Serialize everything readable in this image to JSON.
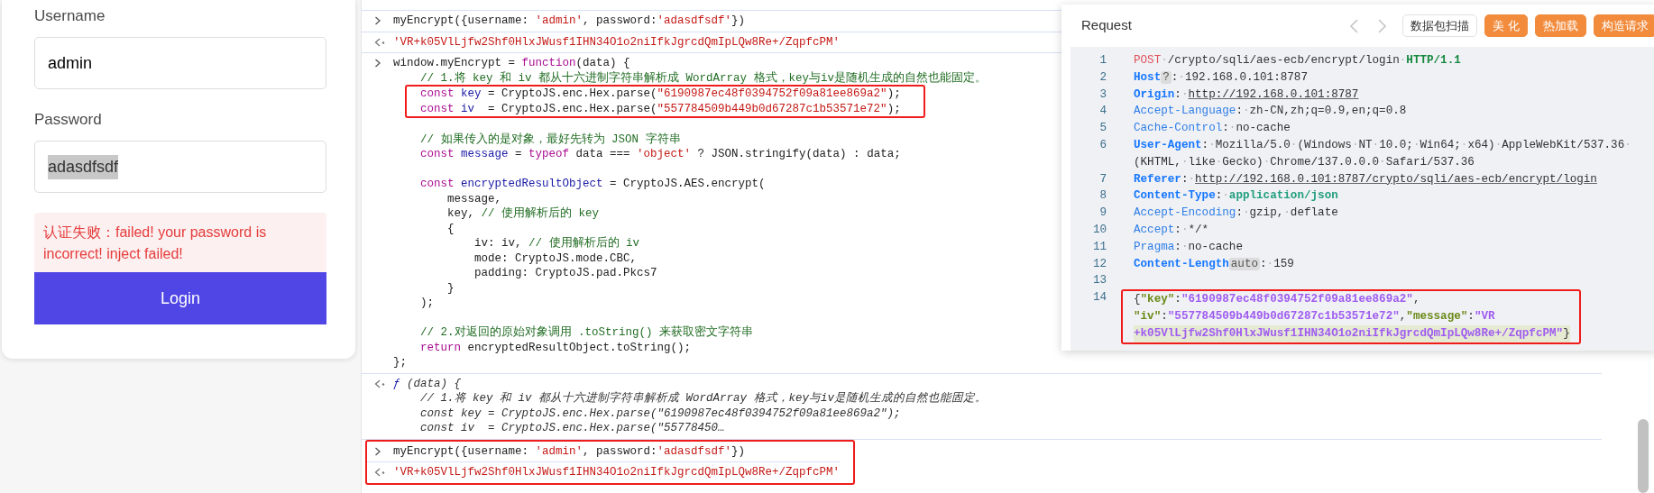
{
  "login_form": {
    "username_label": "Username",
    "username_value": "admin",
    "password_label": "Password",
    "password_value": "adasdfsdf",
    "password_selected": true,
    "error_message": "认证失败：failed! your password is incorrect! inject failed!",
    "login_button": "Login"
  },
  "console": {
    "entries": [
      {
        "kind": "input",
        "boxed": false,
        "lines": [
          {
            "boxed": false,
            "tokens": [
              {
                "kind": "pln",
                "text": "myEncrypt({username: "
              },
              {
                "kind": "str",
                "text": "'admin'"
              },
              {
                "kind": "pln",
                "text": ", password:"
              },
              {
                "kind": "str",
                "text": "'adasdfsdf'"
              },
              {
                "kind": "pln",
                "text": "})"
              }
            ]
          }
        ]
      },
      {
        "kind": "result",
        "boxed": false,
        "lines": [
          {
            "boxed": false,
            "tokens": [
              {
                "kind": "str",
                "text": "'VR+k05VlLjfw2Shf0HlxJWusf1IHN34O1o2niIfkJgrcdQmIpLQw8Re+/ZqpfcPM'"
              }
            ]
          }
        ]
      },
      {
        "kind": "input",
        "boxed": false,
        "lines": [
          {
            "boxed": false,
            "tokens": [
              {
                "kind": "pln",
                "text": "window.myEncrypt = "
              },
              {
                "kind": "kw",
                "text": "function"
              },
              {
                "kind": "pln",
                "text": "(data) {"
              }
            ]
          },
          {
            "boxed": false,
            "tokens": [
              {
                "kind": "com",
                "text": "    // 1.将 key 和 iv 都从十六进制字符串解析成 WordArray 格式，key与iv是随机生成的自然也能固定。"
              }
            ]
          },
          {
            "boxed": true,
            "tokens": [
              {
                "kind": "kw",
                "text": "    const "
              },
              {
                "kind": "def",
                "text": "key"
              },
              {
                "kind": "pln",
                "text": " = CryptoJS.enc.Hex.parse("
              },
              {
                "kind": "str",
                "text": "\"6190987ec48f0394752f09a81ee869a2\""
              },
              {
                "kind": "pln",
                "text": ");"
              }
            ]
          },
          {
            "boxed": true,
            "tokens": [
              {
                "kind": "kw",
                "text": "    const "
              },
              {
                "kind": "def",
                "text": "iv"
              },
              {
                "kind": "pln",
                "text": "  = CryptoJS.enc.Hex.parse("
              },
              {
                "kind": "str",
                "text": "\"557784509b449b0d67287c1b53571e72\""
              },
              {
                "kind": "pln",
                "text": ");"
              }
            ]
          },
          {
            "boxed": false
          },
          {
            "boxed": false,
            "tokens": [
              {
                "kind": "com",
                "text": "    // 如果传入的是对象，最好先转为 JSON 字符串"
              }
            ]
          },
          {
            "boxed": false,
            "tokens": [
              {
                "kind": "kw",
                "text": "    const "
              },
              {
                "kind": "def",
                "text": "message"
              },
              {
                "kind": "pln",
                "text": " = "
              },
              {
                "kind": "kw",
                "text": "typeof"
              },
              {
                "kind": "pln",
                "text": " data === "
              },
              {
                "kind": "str",
                "text": "'object'"
              },
              {
                "kind": "pln",
                "text": " ? JSON.stringify(data) : data;"
              }
            ]
          },
          {
            "boxed": false
          },
          {
            "boxed": false,
            "tokens": [
              {
                "kind": "kw",
                "text": "    const "
              },
              {
                "kind": "def",
                "text": "encryptedResultObject"
              },
              {
                "kind": "pln",
                "text": " = CryptoJS.AES.encrypt("
              }
            ]
          },
          {
            "boxed": false,
            "tokens": [
              {
                "kind": "pln",
                "text": "        message,"
              }
            ]
          },
          {
            "boxed": false,
            "tokens": [
              {
                "kind": "pln",
                "text": "        key, "
              },
              {
                "kind": "com",
                "text": "// 使用解析后的 key"
              }
            ]
          },
          {
            "boxed": false,
            "tokens": [
              {
                "kind": "pln",
                "text": "        {"
              }
            ]
          },
          {
            "boxed": false,
            "tokens": [
              {
                "kind": "pln",
                "text": "            iv: iv, "
              },
              {
                "kind": "com",
                "text": "// 使用解析后的 iv"
              }
            ]
          },
          {
            "boxed": false,
            "tokens": [
              {
                "kind": "pln",
                "text": "            mode: CryptoJS.mode.CBC,"
              }
            ]
          },
          {
            "boxed": false,
            "tokens": [
              {
                "kind": "pln",
                "text": "            padding: CryptoJS.pad.Pkcs7"
              }
            ]
          },
          {
            "boxed": false,
            "tokens": [
              {
                "kind": "pln",
                "text": "        }"
              }
            ]
          },
          {
            "boxed": false,
            "tokens": [
              {
                "kind": "pln",
                "text": "    );"
              }
            ]
          },
          {
            "boxed": false
          },
          {
            "boxed": false,
            "tokens": [
              {
                "kind": "com",
                "text": "    // 2.对返回的原始对象调用 .toString() 来获取密文字符串"
              }
            ]
          },
          {
            "boxed": false,
            "tokens": [
              {
                "kind": "kw",
                "text": "    return "
              },
              {
                "kind": "pln",
                "text": "encryptedResultObject.toString();"
              }
            ]
          },
          {
            "boxed": false,
            "tokens": [
              {
                "kind": "pln",
                "text": "};"
              }
            ]
          }
        ]
      },
      {
        "kind": "result",
        "boxed": false,
        "lines": [
          {
            "boxed": false,
            "tokens": [
              {
                "kind": "fn",
                "text": "ƒ"
              },
              {
                "kind": "it",
                "text": " (data) {"
              }
            ]
          },
          {
            "boxed": false,
            "tokens": [
              {
                "kind": "it",
                "text": "    // 1.将 key 和 iv 都从十六进制字符串解析成 WordArray 格式，key与iv是随机生成的自然也能固定。"
              }
            ]
          },
          {
            "boxed": false,
            "tokens": [
              {
                "kind": "it",
                "text": "    const key = CryptoJS.enc.Hex.parse(\"6190987ec48f0394752f09a81ee869a2\");"
              }
            ]
          },
          {
            "boxed": false,
            "tokens": [
              {
                "kind": "it",
                "text": "    const iv  = CryptoJS.enc.Hex.parse(\"55778450…"
              }
            ]
          }
        ]
      },
      {
        "kind": "input",
        "boxed": true,
        "lines": [
          {
            "boxed": false,
            "tokens": [
              {
                "kind": "pln",
                "text": "myEncrypt({username: "
              },
              {
                "kind": "str",
                "text": "'admin'"
              },
              {
                "kind": "pln",
                "text": ", password:"
              },
              {
                "kind": "str",
                "text": "'adasdfsdf'"
              },
              {
                "kind": "pln",
                "text": "})"
              }
            ]
          }
        ]
      },
      {
        "kind": "result",
        "boxed": true,
        "lines": [
          {
            "boxed": false,
            "tokens": [
              {
                "kind": "str",
                "text": "'VR+k05VlLjfw2Shf0HlxJWusf1IHN34O1o2niIfkJgrcdQmIpLQw8Re+/ZqpfcPM'"
              }
            ]
          }
        ]
      }
    ]
  },
  "request_panel": {
    "title": "Request",
    "toolbar_buttons": [
      {
        "label": "数据包扫描",
        "kind": "outline"
      },
      {
        "label": "美 化",
        "kind": "accent"
      },
      {
        "label": "热加载",
        "kind": "accent"
      },
      {
        "label": "构造请求",
        "kind": "accent"
      }
    ],
    "editor_lines": [
      {
        "number": "1",
        "boxed": false,
        "current": false,
        "rows": [
          [
            {
              "kind": "method",
              "text": "POST"
            },
            {
              "kind": "pln",
              "text": "·/crypto/sqli/aes-ecb/encrypt/login·"
            },
            {
              "kind": "ver",
              "text": "HTTP/1.1"
            }
          ]
        ]
      },
      {
        "number": "2",
        "boxed": false,
        "current": false,
        "rows": [
          [
            {
              "kind": "hb",
              "text": "Host"
            },
            {
              "kind": "tag",
              "text": "?"
            },
            {
              "kind": "pln",
              "text": ":·192.168.0.101:8787"
            }
          ]
        ]
      },
      {
        "number": "3",
        "boxed": false,
        "current": false,
        "rows": [
          [
            {
              "kind": "hb",
              "text": "Origin"
            },
            {
              "kind": "pln",
              "text": ":·"
            },
            {
              "kind": "link",
              "text": "http://192.168.0.101:8787"
            }
          ]
        ]
      },
      {
        "number": "4",
        "boxed": false,
        "current": false,
        "rows": [
          [
            {
              "kind": "hn",
              "text": "Accept-Language"
            },
            {
              "kind": "pln",
              "text": ":·zh-CN,zh;q=0.9,en;q=0.8"
            }
          ]
        ]
      },
      {
        "number": "5",
        "boxed": false,
        "current": false,
        "rows": [
          [
            {
              "kind": "hn",
              "text": "Cache-Control"
            },
            {
              "kind": "pln",
              "text": ":·no-cache"
            }
          ]
        ]
      },
      {
        "number": "6",
        "boxed": false,
        "current": false,
        "rows": [
          [
            {
              "kind": "hb",
              "text": "User-Agent"
            },
            {
              "kind": "pln",
              "text": ":·Mozilla/5.0·(Windows·NT·10.0;·Win64;·x64)·AppleWebKit/537.36·"
            }
          ],
          [
            {
              "kind": "pln",
              "text": "(KHTML,·like·Gecko)·Chrome/137.0.0.0·Safari/537.36"
            }
          ]
        ]
      },
      {
        "number": "7",
        "boxed": false,
        "current": false,
        "rows": [
          [
            {
              "kind": "hb",
              "text": "Referer"
            },
            {
              "kind": "pln",
              "text": ":·"
            },
            {
              "kind": "link",
              "text": "http://192.168.0.101:8787/crypto/sqli/aes-ecb/encrypt/login"
            }
          ]
        ]
      },
      {
        "number": "8",
        "boxed": false,
        "current": false,
        "rows": [
          [
            {
              "kind": "hb",
              "text": "Content-Type"
            },
            {
              "kind": "pln",
              "text": ":·"
            },
            {
              "kind": "ct",
              "text": "application/json"
            }
          ]
        ]
      },
      {
        "number": "9",
        "boxed": false,
        "current": false,
        "rows": [
          [
            {
              "kind": "hn",
              "text": "Accept-Encoding"
            },
            {
              "kind": "pln",
              "text": ":·gzip,·deflate"
            }
          ]
        ]
      },
      {
        "number": "10",
        "boxed": false,
        "current": false,
        "rows": [
          [
            {
              "kind": "hn",
              "text": "Accept"
            },
            {
              "kind": "pln",
              "text": ":·*/*"
            }
          ]
        ]
      },
      {
        "number": "11",
        "boxed": false,
        "current": false,
        "rows": [
          [
            {
              "kind": "hn",
              "text": "Pragma"
            },
            {
              "kind": "pln",
              "text": ":·no-cache"
            }
          ]
        ]
      },
      {
        "number": "12",
        "boxed": false,
        "current": false,
        "rows": [
          [
            {
              "kind": "hb",
              "text": "Content-Length"
            },
            {
              "kind": "tag",
              "text": "auto"
            },
            {
              "kind": "pln",
              "text": ":·159"
            }
          ]
        ]
      },
      {
        "number": "13",
        "boxed": false,
        "current": false
      },
      {
        "number": "14",
        "boxed": true,
        "current": true,
        "rows": [
          [
            {
              "kind": "jp",
              "text": "{"
            },
            {
              "kind": "jk",
              "text": "\"key\""
            },
            {
              "kind": "jp",
              "text": ":"
            },
            {
              "kind": "js",
              "text": "\"6190987ec48f0394752f09a81ee869a2\""
            },
            {
              "kind": "jp",
              "text": ","
            }
          ],
          [
            {
              "kind": "jk",
              "text": "\"iv\""
            },
            {
              "kind": "jp",
              "text": ":"
            },
            {
              "kind": "js",
              "text": "\"557784509b449b0d67287c1b53571e72\""
            },
            {
              "kind": "jp",
              "text": ","
            },
            {
              "kind": "jk",
              "text": "\"message\""
            },
            {
              "kind": "jp",
              "text": ":"
            },
            {
              "kind": "js",
              "text": "\"VR"
            }
          ],
          [
            {
              "kind": "js",
              "text": "+k05VlLjfw2Shf0HlxJWusf1IHN34O1o2niIfkJgrcdQmIpLQw8Re+/ZqpfcPM\""
            },
            {
              "kind": "jp",
              "text": "}"
            }
          ]
        ]
      }
    ]
  }
}
